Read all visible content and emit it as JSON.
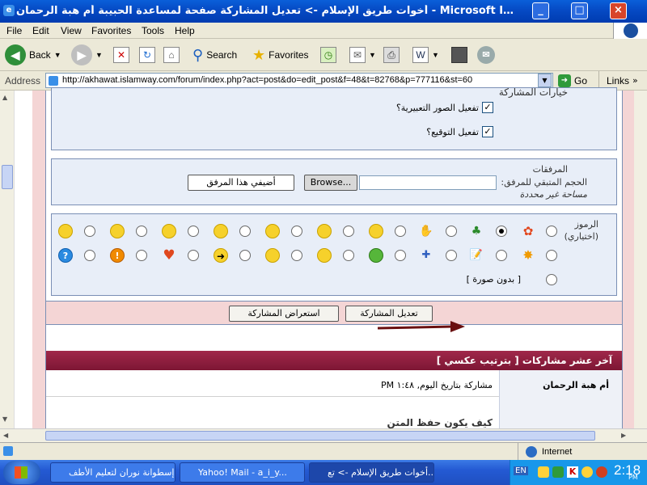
{
  "window": {
    "title": "أخوات طريق الإسلام -> تعديل المشاركة صفحة لمساعدة الحبيبة أم هبة الرحمان - Microsoft Internet Explo..."
  },
  "menu": [
    "File",
    "Edit",
    "View",
    "Favorites",
    "Tools",
    "Help"
  ],
  "toolbar": {
    "back": "Back",
    "search": "Search",
    "favorites": "Favorites"
  },
  "address": {
    "label": "Address",
    "url": "http://akhawat.islamway.com/forum/index.php?act=post&do=edit_post&f=48&t=82768&p=777116&st=60",
    "go": "Go",
    "links": "Links"
  },
  "options": {
    "header": "خيارات المشاركة",
    "emoticons_label": "تفعيل الصور التعبيرية؟",
    "signature_label": "تفعيل التوقيع؟"
  },
  "attachments": {
    "label": "المرفقات",
    "remaining": "الحجم المتبقي للمرفق:",
    "unlimited": "مساحة غير محددة",
    "browse": "Browse...",
    "add": "أضيفي هذا المرفق"
  },
  "emoticons": {
    "label": "الرموز",
    "optional": "(اختياري)",
    "none": "[ بدون صورة ]"
  },
  "actions": {
    "submit": "تعديل المشاركة",
    "preview": "استعراض المشاركة"
  },
  "last_posts": {
    "header": "آخر عشر مشاركات [ بترتيب عكسي ]",
    "author": "أم هبة الرحمان",
    "posted": "مشاركة بتاريخ اليوم, ١:٤٨ PM",
    "snippet": "كيف يكون حفظ المتن"
  },
  "status": {
    "zone": "Internet"
  },
  "taskbar": {
    "items": [
      "إسطوانة نوران لتعليم الأطف...",
      "Yahoo! Mail - a_i_y...",
      "أخوات طريق الإسلام -> تع..."
    ],
    "lang": "EN",
    "clock": "2:18",
    "ampm": "PM"
  },
  "colors": {
    "title_bar": "#0548c2",
    "page_bg": "#f4d5d5",
    "panel_border": "#7a8fb5",
    "header_maroon": "#8b1a3a"
  }
}
